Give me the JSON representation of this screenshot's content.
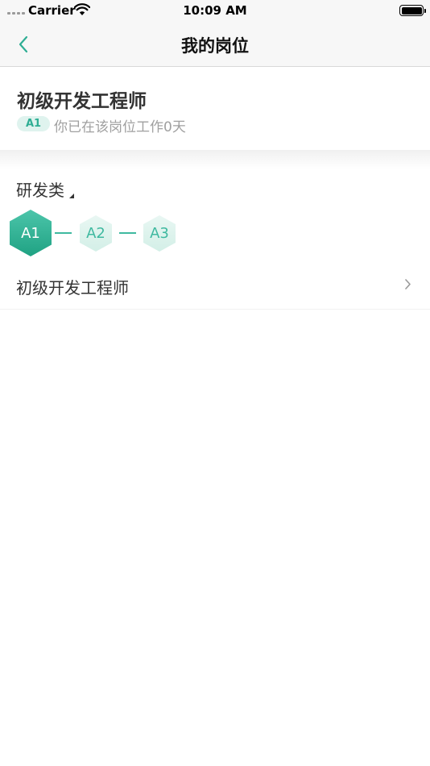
{
  "status_bar": {
    "carrier": "Carrier",
    "time": "10:09 AM"
  },
  "nav": {
    "title": "我的岗位"
  },
  "current_position": {
    "title": "初级开发工程师",
    "level_tag": "A1",
    "tenure_text": "你已在该岗位工作0天"
  },
  "category": {
    "label": "研发类"
  },
  "levels": [
    {
      "label": "A1",
      "active": true
    },
    {
      "label": "A2",
      "active": false
    },
    {
      "label": "A3",
      "active": false
    }
  ],
  "position_list": [
    {
      "name": "初级开发工程师"
    }
  ],
  "colors": {
    "accent": "#2fae94",
    "accent_light": "#dff3ee",
    "text_primary": "#333333",
    "text_secondary": "#a0a0a0"
  },
  "icons": {
    "back": "chevron-left-icon",
    "category_caret": "caret-down-icon",
    "row_arrow": "chevron-right-icon"
  }
}
